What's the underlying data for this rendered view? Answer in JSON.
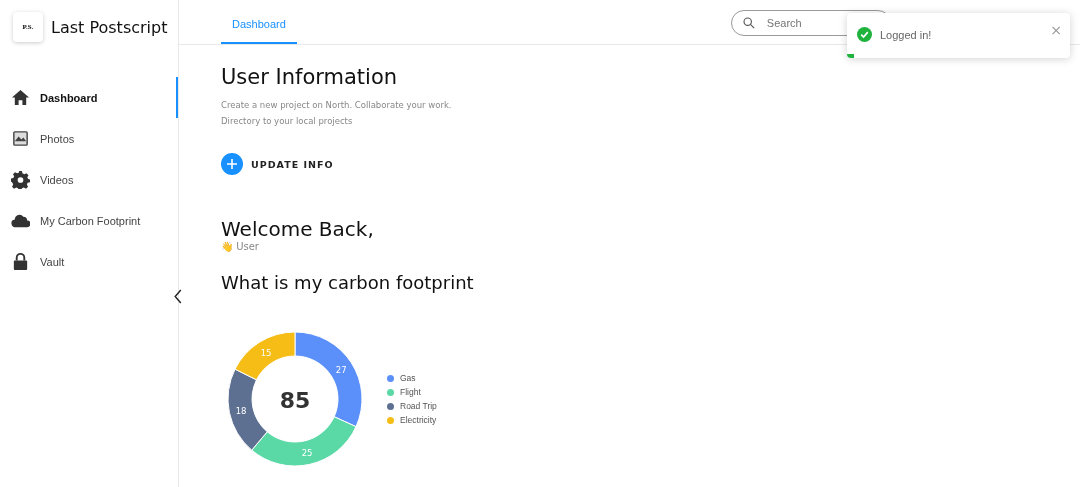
{
  "brand": {
    "logo": "P.S.",
    "name": "Last Postscript"
  },
  "sidebar": {
    "items": [
      {
        "label": "Dashboard",
        "selected": true
      },
      {
        "label": "Photos",
        "selected": false
      },
      {
        "label": "Videos",
        "selected": false
      },
      {
        "label": "My Carbon Footprint",
        "selected": false
      },
      {
        "label": "Vault",
        "selected": false
      }
    ]
  },
  "tabs": [
    {
      "label": "Dashboard",
      "selected": true
    }
  ],
  "search": {
    "placeholder": "Search"
  },
  "toast": {
    "message": "Logged in!",
    "close": "×",
    "level": 0.03
  },
  "user_info": {
    "title": "User Information",
    "description": "Create a new project on North. Collaborate your work. Directory to your local projects",
    "button": "UPDATE INFO"
  },
  "welcome": {
    "title": "Welcome Back,",
    "user": "👋 User"
  },
  "carbon": {
    "title": "What is my carbon footprint",
    "total": "85",
    "chart_data": {
      "type": "donut",
      "categories": [
        "Gas",
        "Flight",
        "Road Trip",
        "Electricity"
      ],
      "values": [
        27,
        25,
        18,
        15
      ],
      "legend": "right",
      "colors": [
        "#5b8ff9",
        "#5ad8a6",
        "#5d7092",
        "#f6bd16"
      ],
      "data_labels": true
    }
  }
}
